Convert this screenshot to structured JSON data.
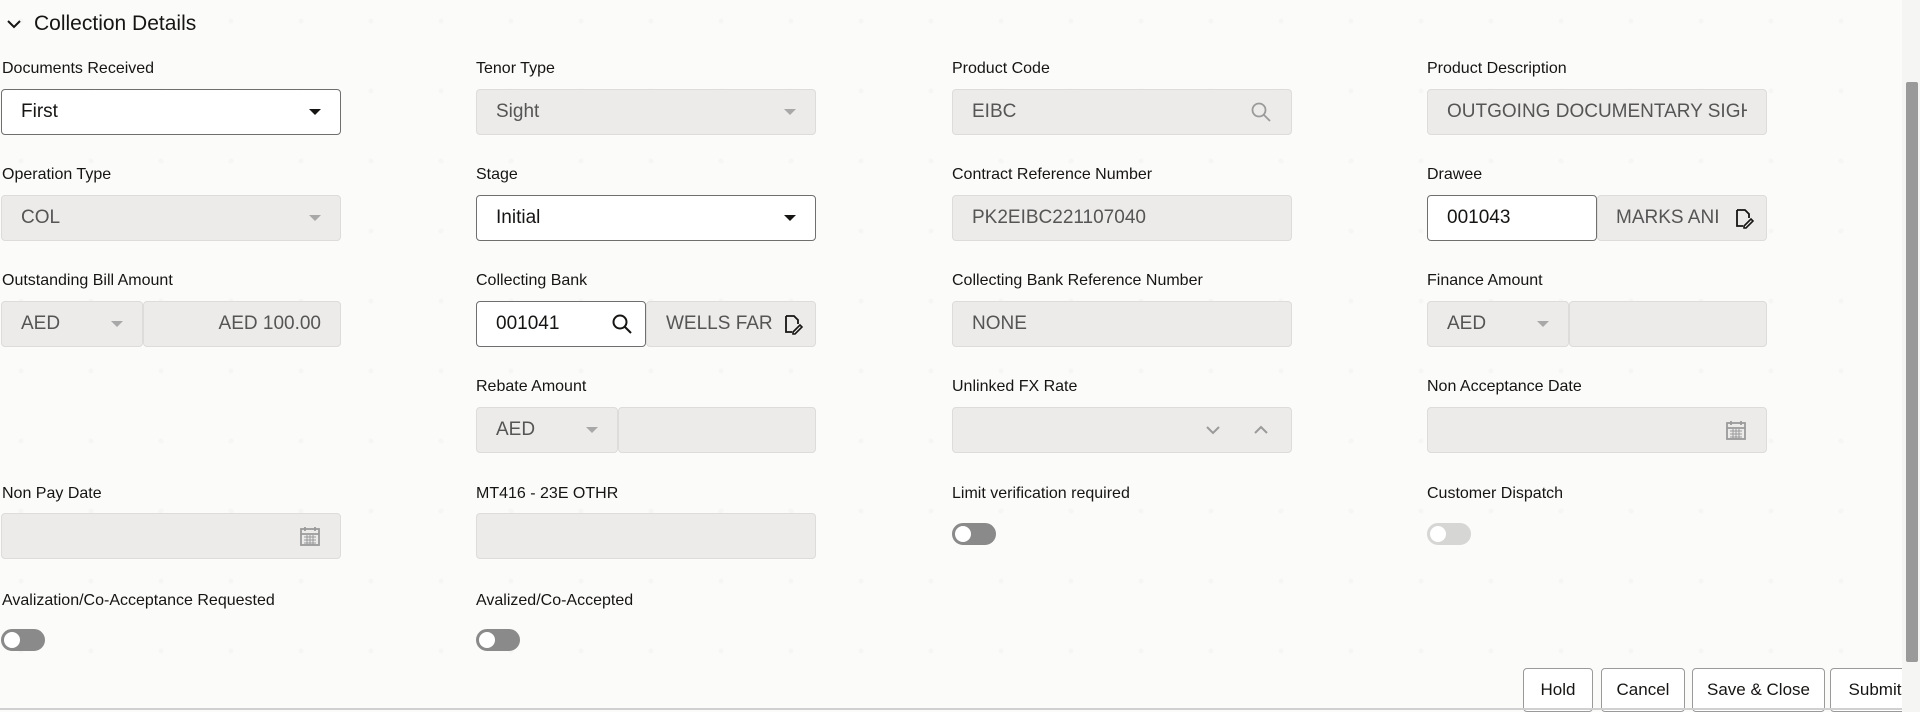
{
  "section": {
    "title": "Collection Details"
  },
  "fields": {
    "documents_received": {
      "label": "Documents Received",
      "value": "First"
    },
    "tenor_type": {
      "label": "Tenor Type",
      "value": "Sight"
    },
    "product_code": {
      "label": "Product Code",
      "value": "EIBC"
    },
    "product_description": {
      "label": "Product Description",
      "value": "OUTGOING DOCUMENTARY SIGHT"
    },
    "operation_type": {
      "label": "Operation Type",
      "value": "COL"
    },
    "stage": {
      "label": "Stage",
      "value": "Initial"
    },
    "contract_reference_number": {
      "label": "Contract Reference Number",
      "value": "PK2EIBC221107040"
    },
    "drawee": {
      "label": "Drawee",
      "code": "001043",
      "name": "MARKS ANI"
    },
    "outstanding_bill_amount": {
      "label": "Outstanding Bill Amount",
      "currency": "AED",
      "amount": "AED 100.00"
    },
    "collecting_bank": {
      "label": "Collecting Bank",
      "code": "001041",
      "name": "WELLS FAR"
    },
    "collecting_bank_reference_number": {
      "label": "Collecting Bank Reference Number",
      "value": "NONE"
    },
    "finance_amount": {
      "label": "Finance Amount",
      "currency": "AED",
      "amount": ""
    },
    "rebate_amount": {
      "label": "Rebate Amount",
      "currency": "AED",
      "amount": ""
    },
    "unlinked_fx_rate": {
      "label": "Unlinked FX Rate",
      "value": ""
    },
    "non_acceptance_date": {
      "label": "Non Acceptance Date",
      "value": ""
    },
    "non_pay_date": {
      "label": "Non Pay Date",
      "value": ""
    },
    "mt416_23e_othr": {
      "label": "MT416 - 23E OTHR",
      "value": ""
    },
    "limit_verification_required": {
      "label": "Limit verification required",
      "on": false
    },
    "customer_dispatch": {
      "label": "Customer Dispatch",
      "on": false
    },
    "avalization_requested": {
      "label": "Avalization/Co-Acceptance Requested",
      "on": false
    },
    "avalized": {
      "label": "Avalized/Co-Accepted",
      "on": false
    }
  },
  "buttons": {
    "hold": "Hold",
    "cancel": "Cancel",
    "save_close": "Save & Close",
    "submit": "Submit"
  },
  "icons": {
    "chevron": "chevron-down-icon",
    "search": "search-icon",
    "document": "document-edit-icon",
    "calendar": "calendar-icon",
    "spinner": "spinner-arrows-icon"
  }
}
